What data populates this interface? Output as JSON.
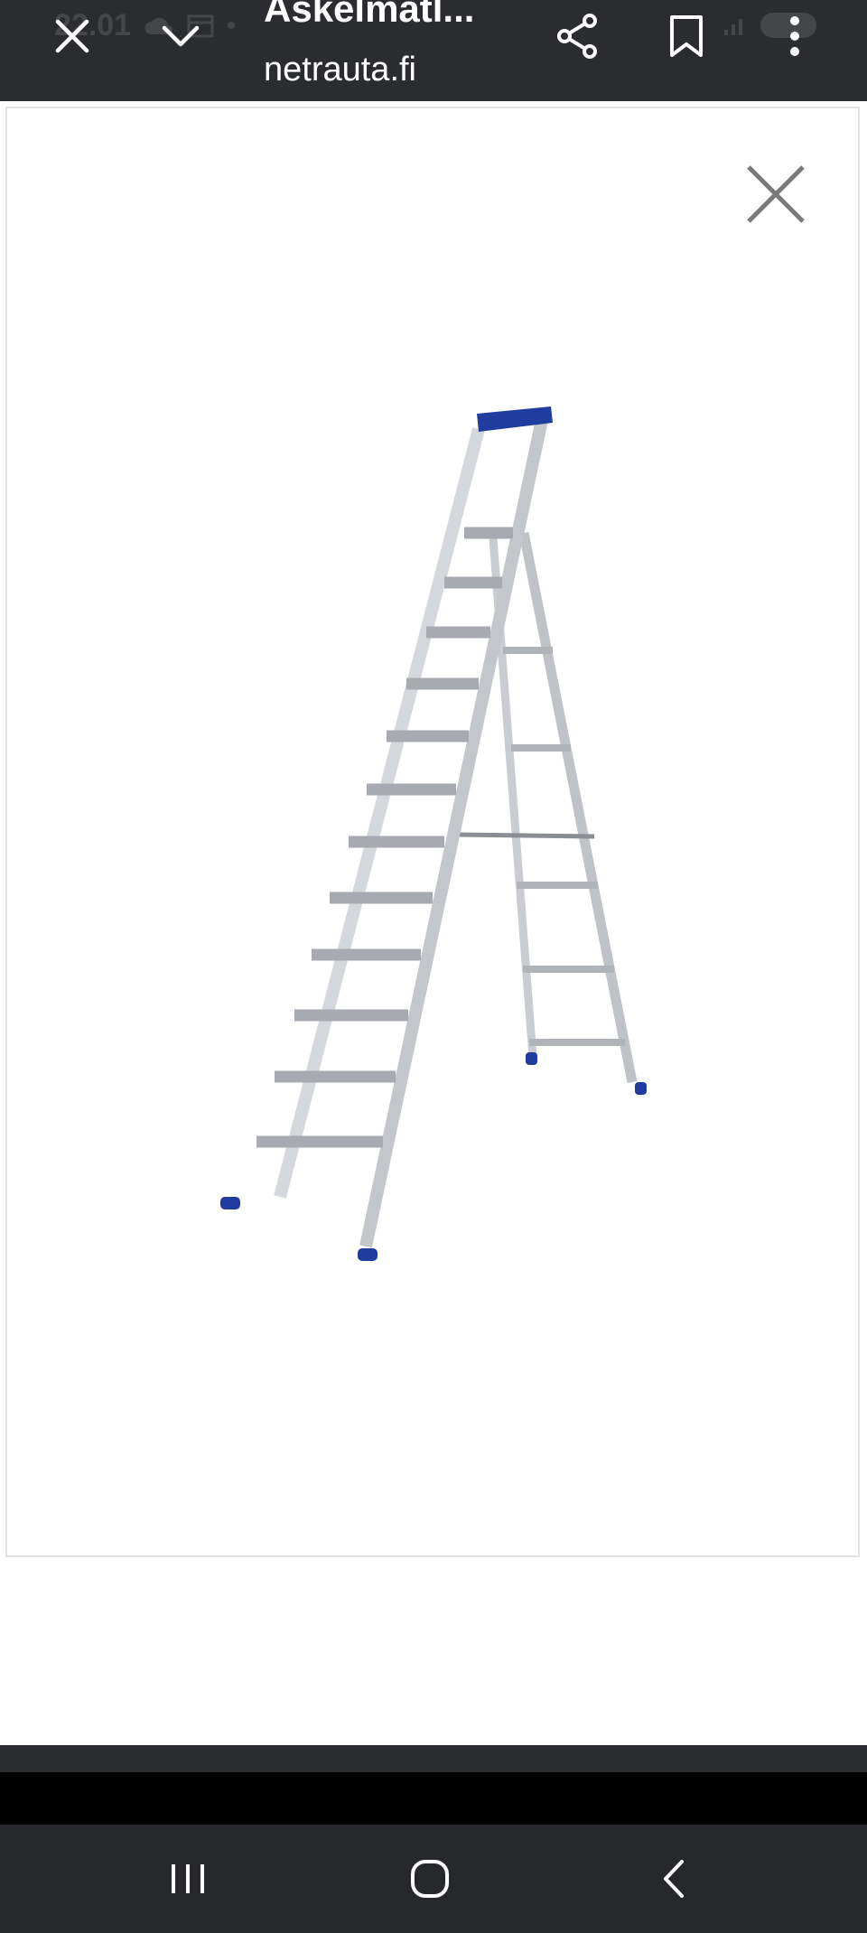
{
  "status": {
    "time": "22.01"
  },
  "browser": {
    "title": "Askelmatl...",
    "domain": "netrauta.fi"
  },
  "icons": {
    "close": "close-icon",
    "collapse": "chevron-down-icon",
    "share": "share-icon",
    "bookmark": "bookmark-icon",
    "more": "more-vert-icon",
    "viewer_close": "close-icon",
    "recents": "recents-icon",
    "home": "home-icon",
    "back": "back-icon"
  },
  "colors": {
    "toolbar": "#2b2c30",
    "ladder_aluminium": "#c9ccd1",
    "ladder_caps": "#1f3c9e",
    "navbar": "#27282c"
  }
}
